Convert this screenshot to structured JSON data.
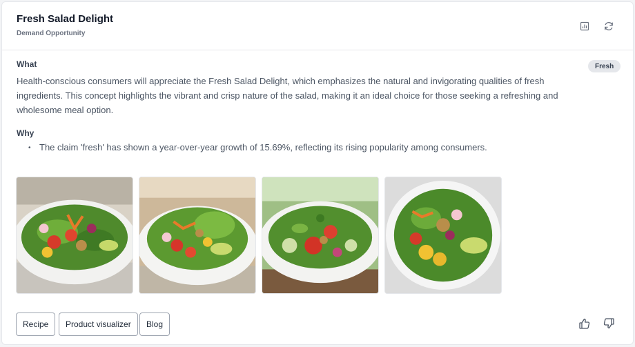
{
  "header": {
    "title": "Fresh Salad Delight",
    "subtitle": "Demand Opportunity",
    "icons": [
      "chart-icon",
      "refresh-icon"
    ]
  },
  "badge": "Fresh",
  "what": {
    "label": "What",
    "text": "Health-conscious consumers will appreciate the Fresh Salad Delight, which emphasizes the natural and invigorating qualities of fresh ingredients. This concept highlights the vibrant and crisp nature of the salad, making it an ideal choice for those seeking a refreshing and wholesome meal option."
  },
  "why": {
    "label": "Why",
    "items": [
      "The claim 'fresh' has shown a year-over-year growth of 15.69%, reflecting its rising popularity among consumers."
    ]
  },
  "images": [
    "salad-image-1",
    "salad-image-2",
    "salad-image-3",
    "salad-image-4"
  ],
  "actions": {
    "recipe": "Recipe",
    "product_visualizer": "Product visualizer",
    "blog": "Blog"
  },
  "feedback": [
    "thumbs-up-icon",
    "thumbs-down-icon"
  ]
}
